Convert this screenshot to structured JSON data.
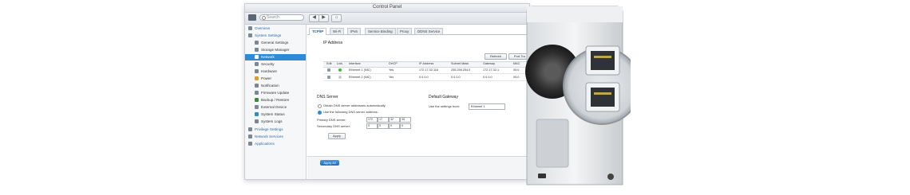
{
  "window": {
    "title": "Control Panel"
  },
  "toolbar": {
    "search_placeholder": "Search",
    "back": "◀",
    "forward": "▶",
    "home": "⌂"
  },
  "sidebar": {
    "overview": "Overview",
    "system_settings": "System Settings",
    "items": [
      "General Settings",
      "Storage Manager",
      "Network",
      "Security",
      "Hardware",
      "Power",
      "Notification",
      "Firmware Update",
      "Backup / Restore",
      "External Device",
      "System Status",
      "System Logs"
    ],
    "privilege_settings": "Privilege Settings",
    "network_services": "Network Services",
    "applications": "Applications"
  },
  "tabs": [
    "TCP/IP",
    "Wi-Fi",
    "IPv6",
    "Service Binding",
    "Proxy",
    "DDNS Service"
  ],
  "ip_address": {
    "title": "IP Address",
    "refresh": "Refresh",
    "port_trunking": "Port Tru",
    "columns": [
      "Edit",
      "Link",
      "Interface",
      "DHCP",
      "IP Address",
      "Subnet Mask",
      "Gateway",
      "MAC"
    ],
    "rows": [
      {
        "interface": "Ethernet 1 (NIC)",
        "dhcp": "Yes",
        "ip": "172.17.32.116",
        "mask": "255.255.254.0",
        "gateway": "172.17.32.1",
        "mac": "00:0"
      },
      {
        "interface": "Ethernet 2 (NIC)",
        "dhcp": "Yes",
        "ip": "0.0.0.0",
        "mask": "0.0.0.0",
        "gateway": "0.0.0.0",
        "mac": "00:0"
      }
    ]
  },
  "dns": {
    "title": "DNS Server",
    "opt_auto": "Obtain DNS server addresses automatically",
    "opt_manual": "Use the following DNS server address:",
    "primary_label": "Primary DNS server:",
    "secondary_label": "Secondary DNS server:",
    "primary": [
      "172",
      "17",
      "32",
      "35"
    ],
    "secondary": [
      "0",
      "0",
      "0",
      "0"
    ],
    "apply": "Apply"
  },
  "gateway": {
    "title": "Default Gateway",
    "label": "Use the settings from:",
    "value": "Ethernet 1"
  },
  "footer": {
    "apply_all": "Apply All"
  },
  "colors": {
    "accent": "#2d8ad6",
    "link_on": "#3dbb3d"
  }
}
